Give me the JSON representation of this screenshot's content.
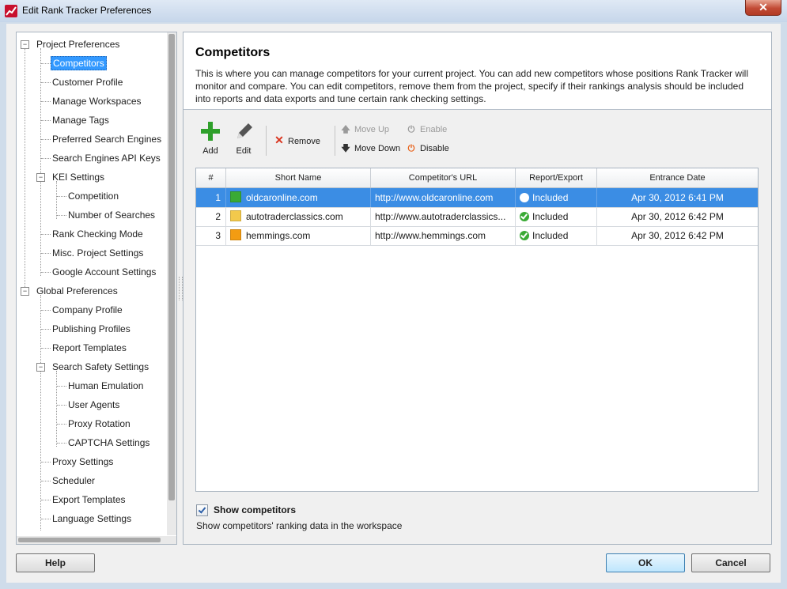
{
  "window": {
    "title": "Edit Rank Tracker Preferences",
    "close_label": "✕"
  },
  "tree": {
    "items": [
      {
        "label": "Project Preferences"
      },
      {
        "label": "Competitors"
      },
      {
        "label": "Customer Profile"
      },
      {
        "label": "Manage Workspaces"
      },
      {
        "label": "Manage Tags"
      },
      {
        "label": "Preferred Search Engines"
      },
      {
        "label": "Search Engines API Keys"
      },
      {
        "label": "KEI Settings"
      },
      {
        "label": "Competition"
      },
      {
        "label": "Number of Searches"
      },
      {
        "label": "Rank Checking Mode"
      },
      {
        "label": "Misc. Project Settings"
      },
      {
        "label": "Google Account Settings"
      },
      {
        "label": "Global Preferences"
      },
      {
        "label": "Company Profile"
      },
      {
        "label": "Publishing Profiles"
      },
      {
        "label": "Report Templates"
      },
      {
        "label": "Search Safety Settings"
      },
      {
        "label": "Human Emulation"
      },
      {
        "label": "User Agents"
      },
      {
        "label": "Proxy Rotation"
      },
      {
        "label": "CAPTCHA Settings"
      },
      {
        "label": "Proxy Settings"
      },
      {
        "label": "Scheduler"
      },
      {
        "label": "Export Templates"
      },
      {
        "label": "Language Settings"
      }
    ],
    "selected": "Competitors"
  },
  "panel": {
    "title": "Competitors",
    "description": "This is where you can manage competitors for your current project. You can add new competitors whose positions Rank Tracker will monitor and compare. You can edit competitors, remove them from the project, specify if their rankings analysis should be included into reports and data exports and tune certain rank checking settings."
  },
  "toolbar": {
    "add": "Add",
    "edit": "Edit",
    "remove": "Remove",
    "move_up": "Move Up",
    "move_down": "Move Down",
    "enable": "Enable",
    "disable": "Disable"
  },
  "table": {
    "headers": [
      "#",
      "Short Name",
      "Competitor's URL",
      "Report/Export",
      "Entrance Date"
    ],
    "rows": [
      {
        "num": "1",
        "name": "oldcaronline.com",
        "color": "#3aaa35",
        "url": "http://www.oldcaronline.com",
        "report": "Included",
        "date": "Apr 30, 2012 6:41 PM"
      },
      {
        "num": "2",
        "name": "autotraderclassics.com",
        "color": "#f2c94c",
        "url": "http://www.autotraderclassics...",
        "report": "Included",
        "date": "Apr 30, 2012 6:42 PM"
      },
      {
        "num": "3",
        "name": "hemmings.com",
        "color": "#f39c12",
        "url": "http://www.hemmings.com",
        "report": "Included",
        "date": "Apr 30, 2012 6:42 PM"
      }
    ],
    "selected_row": 0
  },
  "show_competitors": {
    "checked": true,
    "label": "Show competitors",
    "description": "Show competitors' ranking data in the workspace"
  },
  "buttons": {
    "help": "Help",
    "ok": "OK",
    "cancel": "Cancel"
  },
  "colors": {
    "accent": "#3399ff",
    "selection_row": "#3b8de4",
    "included_check": "#3aaa35",
    "remove_icon": "#d9341e",
    "disable_icon": "#e8621a",
    "add_icon": "#2fa02b"
  }
}
